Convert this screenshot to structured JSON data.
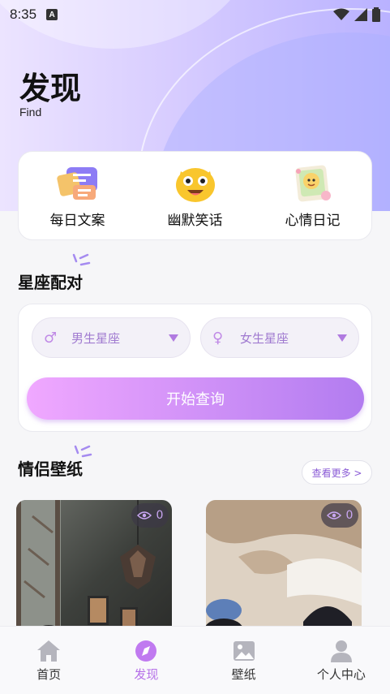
{
  "status": {
    "time": "8:35",
    "badge": "A"
  },
  "header": {
    "title": "发现",
    "subtitle": "Find"
  },
  "features": [
    {
      "label": "每日文案",
      "icon": "copywriting-icon"
    },
    {
      "label": "幽默笑话",
      "icon": "laughing-emoji-icon"
    },
    {
      "label": "心情日记",
      "icon": "mood-diary-icon"
    }
  ],
  "zodiac": {
    "section_title": "星座配对",
    "male_select": "男生星座",
    "female_select": "女生星座",
    "query_button": "开始查询"
  },
  "wallpapers": {
    "section_title": "情侣壁纸",
    "more_button": "查看更多 >",
    "items": [
      {
        "views": "0"
      },
      {
        "views": "0"
      }
    ]
  },
  "tabbar": [
    {
      "label": "首页",
      "icon": "home-icon",
      "active": false
    },
    {
      "label": "发现",
      "icon": "compass-icon",
      "active": true
    },
    {
      "label": "壁纸",
      "icon": "image-icon",
      "active": false
    },
    {
      "label": "个人中心",
      "icon": "user-icon",
      "active": false
    }
  ],
  "colors": {
    "accent": "#b570e8",
    "button_start": "#f0a8ff",
    "button_end": "#b27cf0"
  }
}
